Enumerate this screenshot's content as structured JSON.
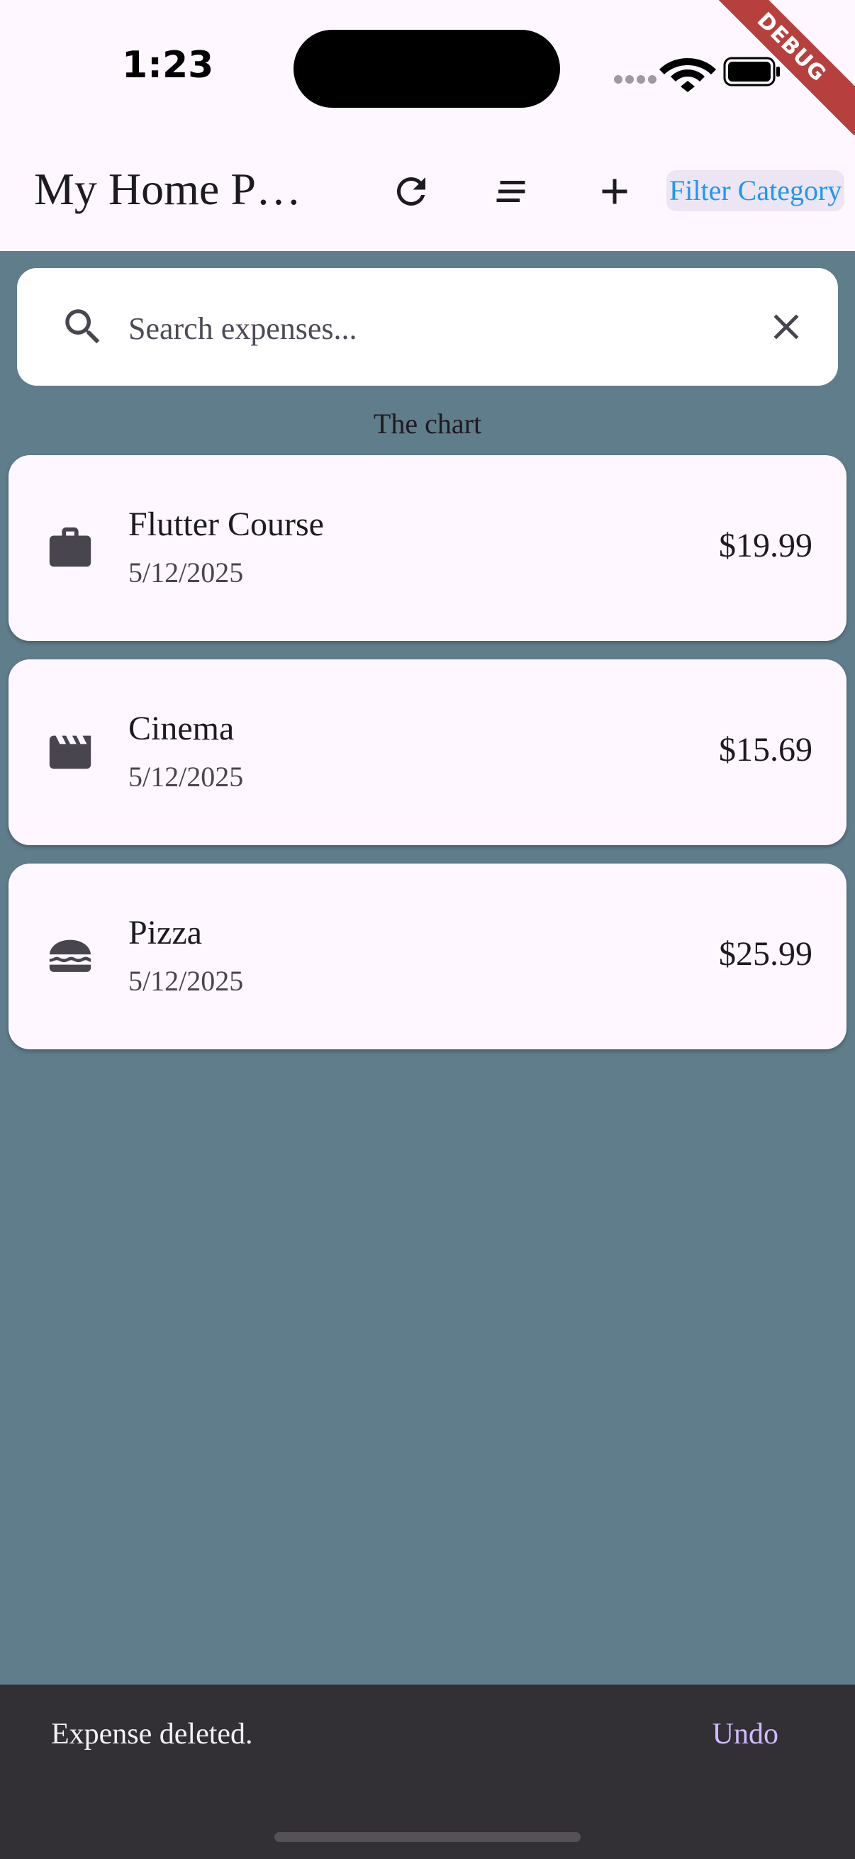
{
  "status_bar": {
    "time": "1:23",
    "debug_label": "DEBUG"
  },
  "app_bar": {
    "title": "My Home P…",
    "refresh_icon": "refresh-icon",
    "sort_icon": "sort-lines-icon",
    "add_icon": "plus-icon",
    "filter_label": "Filter Category",
    "filter_color": "#2196f3"
  },
  "search": {
    "placeholder": "Search expenses...",
    "value": ""
  },
  "chart_label": "The chart",
  "expenses": [
    {
      "title": "Flutter Course",
      "date": "5/12/2025",
      "amount": "$19.99",
      "icon": "briefcase-icon"
    },
    {
      "title": "Cinema",
      "date": "5/12/2025",
      "amount": "$15.69",
      "icon": "clapperboard-icon"
    },
    {
      "title": "Pizza",
      "date": "5/12/2025",
      "amount": "$25.99",
      "icon": "burger-icon"
    }
  ],
  "snackbar": {
    "message": "Expense deleted.",
    "action": "Undo"
  },
  "colors": {
    "background": "#607d8b",
    "surface": "#fef7ff",
    "snackbar": "#322f35",
    "action": "#d0bcff",
    "debug_banner": "#b7403f"
  }
}
